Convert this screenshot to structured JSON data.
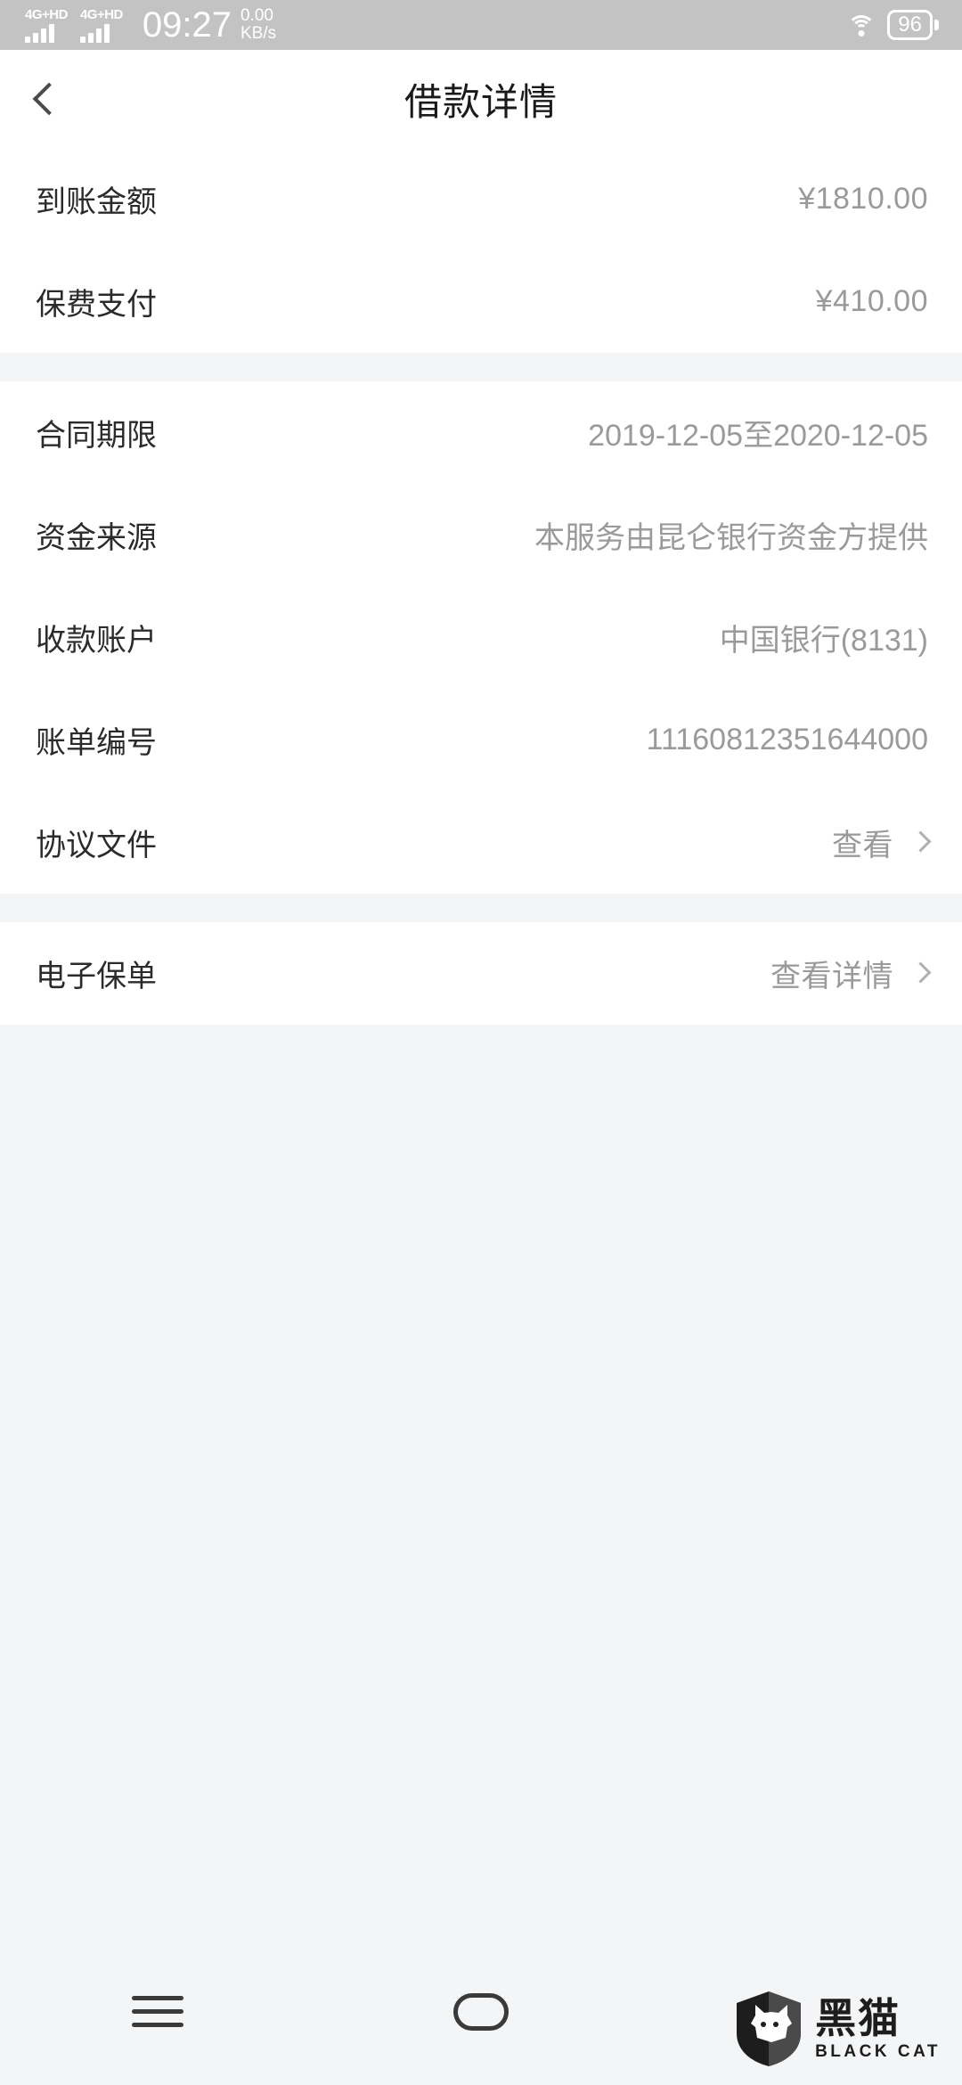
{
  "status_bar": {
    "network_badge_1": "4G+HD",
    "network_badge_2": "4G+HD",
    "time": "09:27",
    "net_speed_value": "0.00",
    "net_speed_unit": "KB/s",
    "wifi_icon": "wifi-icon",
    "battery_level": "96"
  },
  "app_bar": {
    "back_icon": "chevron-left-icon",
    "title": "借款详情"
  },
  "sections": [
    {
      "rows": [
        {
          "label": "到账金额",
          "value": "¥1810.00",
          "has_chevron": false
        },
        {
          "label": "保费支付",
          "value": "¥410.00",
          "has_chevron": false
        }
      ]
    },
    {
      "rows": [
        {
          "label": "合同期限",
          "value": "2019-12-05至2020-12-05",
          "has_chevron": false
        },
        {
          "label": "资金来源",
          "value": "本服务由昆仑银行资金方提供",
          "has_chevron": false
        },
        {
          "label": "收款账户",
          "value": "中国银行(8131)",
          "has_chevron": false
        },
        {
          "label": "账单编号",
          "value": "11160812351644000",
          "has_chevron": false
        },
        {
          "label": "协议文件",
          "value": "查看",
          "has_chevron": true
        }
      ]
    },
    {
      "rows": [
        {
          "label": "电子保单",
          "value": "查看详情",
          "has_chevron": true
        }
      ]
    }
  ],
  "nav_bar": {
    "menu_icon": "menu-icon",
    "home_icon": "home-pill-icon"
  },
  "watermark": {
    "shield_icon": "black-cat-shield-icon",
    "name_cn": "黑猫",
    "name_en": "BLACK CAT"
  },
  "colors": {
    "status_bar_bg": "#c3c3c3",
    "card_bg": "#ffffff",
    "page_bg": "#f4f5f7",
    "label_text": "#2b2b2b",
    "value_text": "#9a9a9a",
    "title_text": "#1a1a1a"
  }
}
